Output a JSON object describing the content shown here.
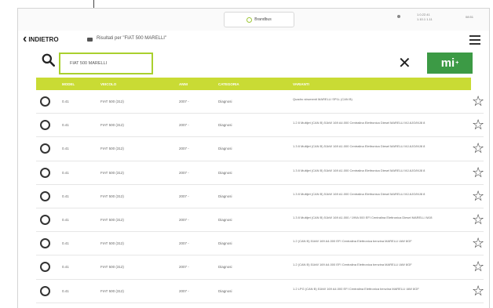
{
  "header": {
    "logo_text": "Brandbus",
    "status_info": "1.0.22.41\n1.10.1 1.11",
    "status_time": "08:51"
  },
  "nav": {
    "back_label": "INDIETRO",
    "breadcrumb": "Risultati per \"FIAT 500 MARELLI\""
  },
  "search": {
    "value": "FIAT 500 MARELLI",
    "clear_symbol": "✕",
    "action_label": "mi",
    "action_superscript": "+"
  },
  "colors": {
    "accent": "#c9db34",
    "search_border": "#a9d02e",
    "action_button": "#3c9a45"
  },
  "table": {
    "headers": [
      "MODEL",
      "VEICOLO",
      "ANNI",
      "CATEGORIA",
      "VARIANTI"
    ],
    "rows": [
      {
        "model": "0.41",
        "vehicle": "FIAT 500 (312)",
        "years": "2007 -",
        "category": "Diagnosi",
        "variant": "Quadro strumenti MARELLI SP1L (CAN B)"
      },
      {
        "model": "0.41",
        "vehicle": "FIAT 500 (312)",
        "years": "2007 -",
        "category": "Diagnosi",
        "variant": "1.2 8 Multijet (CAN B) 51kW 169 A4.000 Centralina Elettronica Diesel MARELLI MJ-6JO/MJ8 8"
      },
      {
        "model": "0.41",
        "vehicle": "FIAT 500 (312)",
        "years": "2007 -",
        "category": "Diagnosi",
        "variant": "1.3 8 Multijet (CAN B) 51kW 169 A1.000 Centralina Elettronica Diesel MARELLI MJ-6JO/MJ8 8"
      },
      {
        "model": "0.41",
        "vehicle": "FIAT 500 (312)",
        "years": "2007 -",
        "category": "Diagnosi",
        "variant": "1.3 8 Multijet (CAN B) 51kW 169 A1.000 Centralina Elettronica Diesel MARELLI MJ-6JO/MJ8 8"
      },
      {
        "model": "0.41",
        "vehicle": "FIAT 500 (312)",
        "years": "2007 -",
        "category": "Diagnosi",
        "variant": "1.3 8 Multijet (CAN B) 51kW 169 A1.000 Centralina Elettronica Diesel MARELLI MJ-6JO/MJ8 8"
      },
      {
        "model": "0.41",
        "vehicle": "FIAT 500 (312)",
        "years": "2007 -",
        "category": "Diagnosi",
        "variant": "1.3 8 Multijet (CAN B) 51kW 169 A1.000 / 199A 000 EFI Centralina Elettronica Diesel MARELLI MJ8"
      },
      {
        "model": "0.41",
        "vehicle": "FIAT 500 (312)",
        "years": "2007 -",
        "category": "Diagnosi",
        "variant": "1.2 (CAN B) 51kW 169 A4.000 EFI Centralina Elettronica benzina MARELLI IAW 8GF"
      },
      {
        "model": "0.41",
        "vehicle": "FIAT 500 (312)",
        "years": "2007 -",
        "category": "Diagnosi",
        "variant": "1.2 (CAN B) 51kW 169 A4.000 EFI Centralina Elettronica benzina MARELLI IAW 8GF"
      },
      {
        "model": "0.41",
        "vehicle": "FIAT 500 (312)",
        "years": "2007 -",
        "category": "Diagnosi",
        "variant": "1.2 LPG (CAN B) 51kW 169 A4.000 EFI Centralina Elettronica benzina MARELLI IAW 8GF"
      }
    ]
  }
}
